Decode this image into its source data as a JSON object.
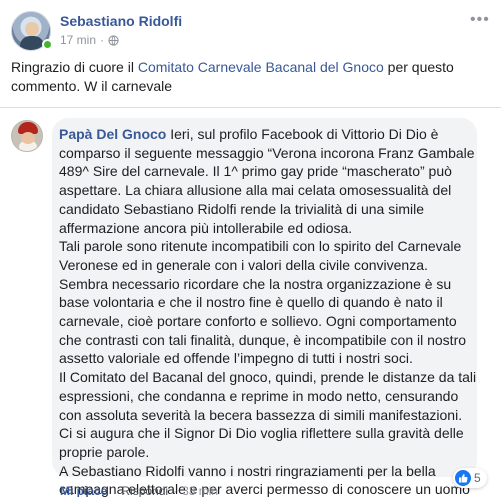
{
  "post": {
    "author": "Sebastiano Ridolfi",
    "time": "17 min",
    "separator": "·",
    "privacy_icon": "globe-icon",
    "more_icon": "•••",
    "text_before": "Ringrazio di cuore il ",
    "text_link": "Comitato Carnevale Bacanal del Gnoco",
    "text_after": " per questo commento. W il carnevale"
  },
  "comment": {
    "author": "Papà Del Gnoco",
    "paragraphs": [
      " Ieri, sul profilo Facebook di Vittorio Di Dio è comparso il seguente messaggio “Verona incorona Franz Gambale 489^ Sire del carnevale. Il 1^ primo gay pride “mascherato” può aspettare. La chiara allusione alla mai celata omosessualità del candidato Sebastiano Ridolfi rende la trivialità di una simile affermazione ancora più intollerabile ed odiosa.",
      "Tali parole sono ritenute incompatibili con lo spirito del Carnevale Veronese ed in generale con i valori della civile convivenza. Sembra necessario ricordare che la nostra organizzazione è su base volontaria e che il nostro fine è quello di quando è nato il carnevale, cioè portare conforto e sollievo. Ogni comportamento che contrasti con tali finalità, dunque, è incompatibile con il nostro assetto valoriale ed offende l’impegno di tutti i nostri soci.",
      "Il Comitato del Bacanal del gnoco, quindi, prende le distanze da tali espressioni, che condanna e reprime in modo netto, censurando con assoluta severità la becera bassezza di simili manifestazioni.",
      "Ci si augura che il Signor Di Dio voglia riflettere sulla gravità delle proprie parole.",
      "A Sebastiano Ridolfi vanno i nostri ringraziamenti per la bella campagna elettorale e per averci permesso di conoscere un uomo meraviglioso e di aver incontrato un nuovo amico."
    ],
    "reaction_count": "5",
    "reaction_icon": "like-icon",
    "like_label": "Mi piace",
    "reply_label": "Rispondi",
    "separator": "·",
    "time": "33 min"
  },
  "colors": {
    "link": "#385898",
    "bubble": "#f2f3f5",
    "like_blue": "#1877f2"
  }
}
